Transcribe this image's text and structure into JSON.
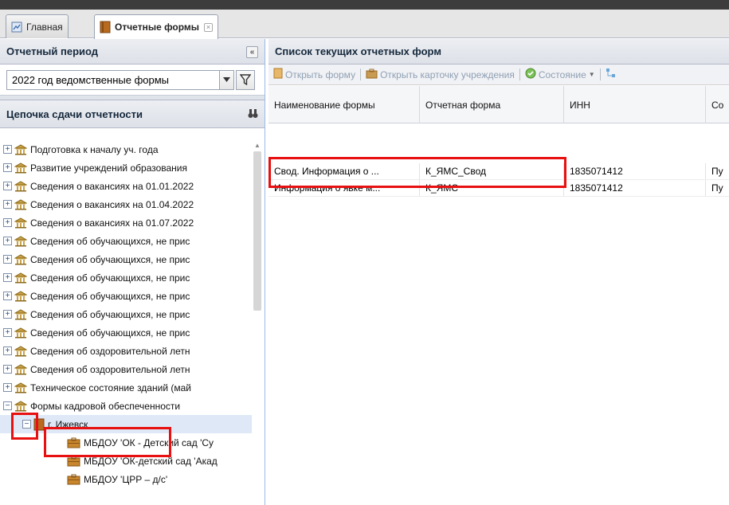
{
  "tabs": [
    {
      "label": "Главная",
      "icon": "home-icon"
    },
    {
      "label": "Отчетные формы",
      "icon": "book-icon",
      "active": true
    }
  ],
  "left": {
    "period_title": "Отчетный период",
    "period_value": "2022 год ведомственные формы",
    "chain_title": "Цепочка сдачи отчетности",
    "tree": [
      {
        "label": "Подготовка к началу уч. года",
        "level": 0,
        "exp": "+"
      },
      {
        "label": "Развитие учреждений образования",
        "level": 0,
        "exp": "+"
      },
      {
        "label": "Сведения о вакансиях на 01.01.2022",
        "level": 0,
        "exp": "+"
      },
      {
        "label": "Сведения о вакансиях на 01.04.2022",
        "level": 0,
        "exp": "+"
      },
      {
        "label": "Сведения о вакансиях на 01.07.2022",
        "level": 0,
        "exp": "+"
      },
      {
        "label": "Сведения об обучающихся, не прис",
        "level": 0,
        "exp": "+"
      },
      {
        "label": "Сведения об обучающихся, не прис",
        "level": 0,
        "exp": "+"
      },
      {
        "label": "Сведения об обучающихся, не прис",
        "level": 0,
        "exp": "+"
      },
      {
        "label": "Сведения об обучающихся, не прис",
        "level": 0,
        "exp": "+"
      },
      {
        "label": "Сведения об обучающихся, не прис",
        "level": 0,
        "exp": "+"
      },
      {
        "label": "Сведения об обучающихся, не прис",
        "level": 0,
        "exp": "+"
      },
      {
        "label": "Сведения об оздоровительной летн",
        "level": 0,
        "exp": "+"
      },
      {
        "label": "Сведения об оздоровительной летн",
        "level": 0,
        "exp": "+"
      },
      {
        "label": "Техническое состояние зданий (май",
        "level": 0,
        "exp": "+"
      },
      {
        "label": "Формы кадровой обеспеченности",
        "level": 0,
        "exp": "−"
      },
      {
        "label": "г. Ижевск",
        "level": 1,
        "exp": "−",
        "selected": true
      },
      {
        "label": "МБДОУ 'ОК - Детский сад 'Су",
        "level": 2
      },
      {
        "label": "МБДОУ 'ОК-детский сад 'Акад",
        "level": 2
      },
      {
        "label": "МБДОУ 'ЦРР – д/с'",
        "level": 2
      }
    ]
  },
  "right": {
    "title": "Список текущих отчетных форм",
    "toolbar": {
      "open_form": "Открыть форму",
      "open_card": "Открыть карточку учреждения",
      "state": "Состояние"
    },
    "columns": [
      "Наименование формы",
      "Отчетная форма",
      "ИНН",
      "Со"
    ],
    "rows": [
      {
        "name": "Свод. Информация о ...",
        "form": "К_ЯМС_Свод",
        "inn": "1835071412",
        "state": "Пу"
      },
      {
        "name": "Информация о явке м...",
        "form": "К_ЯМС",
        "inn": "1835071412",
        "state": "Пу"
      }
    ]
  },
  "colors": {
    "highlight": "#e81010",
    "header_text": "#15283c",
    "selection": "#dfe8f6"
  }
}
